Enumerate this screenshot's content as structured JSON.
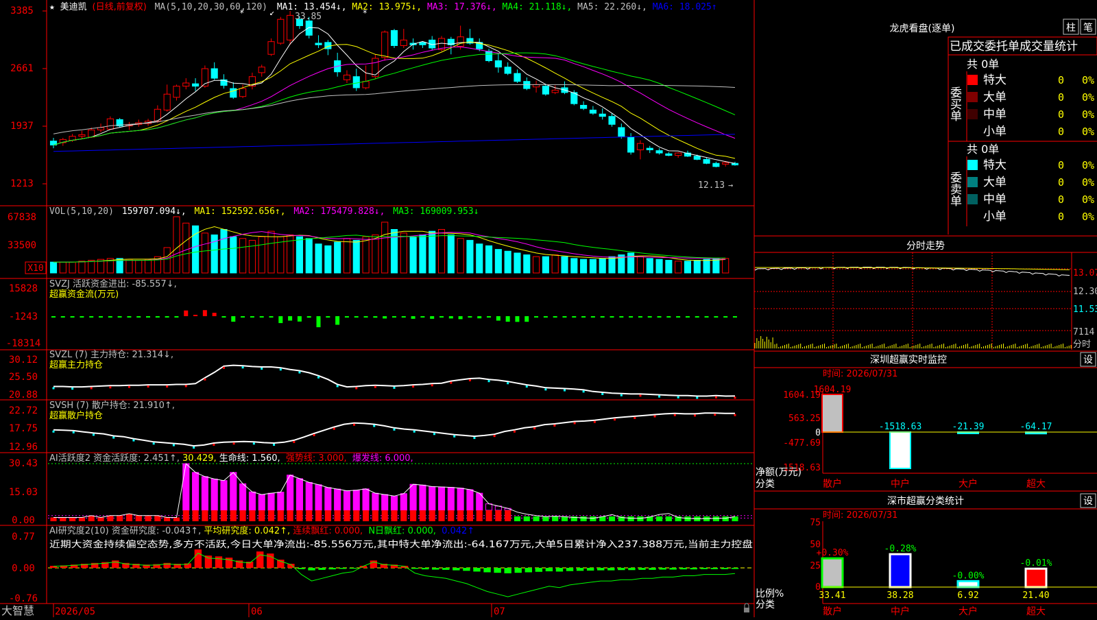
{
  "colors": {
    "up": "#ff0000",
    "down": "#00ffff",
    "ma1": "#ffffff",
    "ma2": "#ffff00",
    "ma3": "#ff00ff",
    "ma4": "#00ff00",
    "ma5": "#c0c0c0",
    "ma6": "#0000ff",
    "axis": "#ff0000",
    "bg": "#000000"
  },
  "header": {
    "star": "★",
    "stock": "美迪凯",
    "period": "(日线,前复权)",
    "ma_params": "MA(5,10,20,30,60,120)",
    "ma1": "MA1: 13.454↓,",
    "ma2": "MA2: 13.975↓,",
    "ma3": "MA3: 17.376↓,",
    "ma4": "MA4: 21.118↓,",
    "ma5": "MA5: 22.260↓,",
    "ma6": "MA6: 18.025↑"
  },
  "price_axis": {
    "ticks": [
      "3385",
      "2661",
      "1937",
      "1213"
    ]
  },
  "annotations": {
    "high": "33.85",
    "low": "12.13"
  },
  "vol_panel": {
    "label": "VOL(5,10,20)",
    "value": "159707.094↓,",
    "ma1": "MA1: 152592.656↑,",
    "ma2": "MA2: 175479.828↓,",
    "ma3": "MA3: 169009.953↓",
    "ticks": [
      "67838",
      "33500"
    ],
    "unit": "X10"
  },
  "svzj_panel": {
    "label": "SVZJ  活跃资金进出: -85.557↓,",
    "sub": "超赢资金流(万元)",
    "ticks": [
      "15828",
      "-1243",
      "-18314"
    ]
  },
  "svzl_panel": {
    "label": "SVZL (7) 主力持仓: 21.314↓,",
    "sub": "超赢主力持仓",
    "ticks": [
      "30.12",
      "25.50",
      "20.88"
    ]
  },
  "svsh_panel": {
    "label": "SVSH (7) 散户持仓: 21.910↑,",
    "sub": "超赢散户持仓",
    "ticks": [
      "22.72",
      "17.75",
      "12.96"
    ]
  },
  "ai1_panel": {
    "label": "AI活跃度2 资金活跃度: 2.451↑,",
    "val2": "30.429,",
    "life": "生命线: 1.560,",
    "strong": "强势线: 3.000,",
    "burst": "爆发线: 6.000,",
    "ticks": [
      "30.43",
      "15.03",
      "0.00"
    ]
  },
  "ai2_panel": {
    "label": "AI研究度2(10) 资金研究度: -0.043↑,",
    "avg": "平均研究度: 0.042↑,",
    "red": "连续飘红: 0.000,",
    "nred": "N日飘红: 0.000,",
    "last": "0.042↑",
    "comment": "近期大资金持续偏空态势,多方不活跃,今日大单净流出:-85.556万元,其中特大单净流出:-64.167万元,大单5日累计净入237.388万元,当前主力控盘",
    "ticks": [
      "0.77",
      "0.00",
      "-0.76"
    ]
  },
  "date_axis": {
    "brand": "大智慧",
    "labels": [
      "2026/05",
      "06",
      "07"
    ]
  },
  "right": {
    "lhb_title": "龙虎看盘(逐单)",
    "btn_zhu": "柱",
    "btn_bi": "笔",
    "tabs": "已成交委托单成交量统计",
    "buy_side": "委买单",
    "sell_side": "委卖单",
    "buy_total": "共 0单",
    "sell_total": "共 0单",
    "buy_rows": [
      {
        "label": "特大",
        "count": "0",
        "pct": "0%",
        "color": "#ff0000"
      },
      {
        "label": "大单",
        "count": "0",
        "pct": "0%",
        "color": "#800000"
      },
      {
        "label": "中单",
        "count": "0",
        "pct": "0%",
        "color": "#400000"
      },
      {
        "label": "小单",
        "count": "0",
        "pct": "0%",
        "color": "#000000"
      }
    ],
    "sell_rows": [
      {
        "label": "特大",
        "count": "0",
        "pct": "0%",
        "color": "#00ffff"
      },
      {
        "label": "大单",
        "count": "0",
        "pct": "0%",
        "color": "#008080"
      },
      {
        "label": "中单",
        "count": "0",
        "pct": "0%",
        "color": "#006060"
      },
      {
        "label": "小单",
        "count": "0",
        "pct": "0%",
        "color": "#000000"
      }
    ],
    "fs_title": "分时走势",
    "fs_ticks": [
      "13.07",
      "12.30",
      "11.53",
      "7114"
    ],
    "fs_unit": "分时",
    "sz_title": "深圳超赢实时监控",
    "sz_set": "设",
    "sz_time": "时间: 2026/07/31",
    "sz_ticks": [
      "1604.19",
      "563.25",
      "0",
      "-477.69",
      "-1518.63"
    ],
    "sz_values": [
      "1604.19",
      "-1518.63",
      "-21.39",
      "-64.17"
    ],
    "sz_cats": [
      "散户",
      "中户",
      "大户",
      "超大"
    ],
    "sz_ylabel": "净额(万元)",
    "sz_xlabel": "分类",
    "ss_title": "深市超赢分类统计",
    "ss_set": "设",
    "ss_time": "时间: 2026/07/31",
    "ss_ticks": [
      "75",
      "50",
      "25",
      "0"
    ],
    "ss_top": [
      "+0.30%",
      "-0.28%",
      "-0.00%",
      "-0.01%"
    ],
    "ss_bottom": [
      "33.41",
      "38.28",
      "6.92",
      "21.40"
    ],
    "ss_cats": [
      "散户",
      "中户",
      "大户",
      "超大"
    ],
    "ss_ylabel": "比例%",
    "ss_xlabel": "分类"
  },
  "chart_data": [
    {
      "type": "candlestick",
      "title": "美迪凯 (日线,前复权)",
      "candles": [
        {
          "o": 17.5,
          "h": 17.9,
          "l": 16.6,
          "c": 17.0
        },
        {
          "o": 17.3,
          "h": 17.9,
          "l": 16.9,
          "c": 17.7
        },
        {
          "o": 17.6,
          "h": 18.4,
          "l": 17.4,
          "c": 18.1
        },
        {
          "o": 18.1,
          "h": 18.8,
          "l": 17.8,
          "c": 18.3
        },
        {
          "o": 18.0,
          "h": 19.2,
          "l": 17.9,
          "c": 18.9
        },
        {
          "o": 18.9,
          "h": 19.7,
          "l": 18.6,
          "c": 19.2
        },
        {
          "o": 19.0,
          "h": 20.6,
          "l": 18.9,
          "c": 20.3
        },
        {
          "o": 20.2,
          "h": 20.4,
          "l": 19.2,
          "c": 19.4
        },
        {
          "o": 19.4,
          "h": 19.9,
          "l": 18.9,
          "c": 19.6
        },
        {
          "o": 19.6,
          "h": 20.2,
          "l": 19.3,
          "c": 19.8
        },
        {
          "o": 19.7,
          "h": 20.3,
          "l": 19.4,
          "c": 20.0
        },
        {
          "o": 20.0,
          "h": 22.0,
          "l": 19.8,
          "c": 21.5
        },
        {
          "o": 21.4,
          "h": 24.6,
          "l": 21.2,
          "c": 23.4
        },
        {
          "o": 23.0,
          "h": 24.6,
          "l": 22.6,
          "c": 24.4
        },
        {
          "o": 24.4,
          "h": 25.4,
          "l": 24.0,
          "c": 24.8
        },
        {
          "o": 24.7,
          "h": 25.4,
          "l": 23.8,
          "c": 24.4
        },
        {
          "o": 24.4,
          "h": 27.0,
          "l": 24.2,
          "c": 26.6
        },
        {
          "o": 26.6,
          "h": 27.4,
          "l": 25.2,
          "c": 25.4
        },
        {
          "o": 25.2,
          "h": 25.9,
          "l": 24.1,
          "c": 24.5
        },
        {
          "o": 24.1,
          "h": 24.9,
          "l": 22.8,
          "c": 23.0
        },
        {
          "o": 23.1,
          "h": 24.6,
          "l": 22.9,
          "c": 24.1
        },
        {
          "o": 24.4,
          "h": 26.1,
          "l": 24.0,
          "c": 25.6
        },
        {
          "o": 26.1,
          "h": 27.1,
          "l": 25.6,
          "c": 26.8
        },
        {
          "o": 28.4,
          "h": 30.4,
          "l": 28.2,
          "c": 30.0
        },
        {
          "o": 29.8,
          "h": 33.1,
          "l": 29.6,
          "c": 32.8
        },
        {
          "o": 30.2,
          "h": 33.85,
          "l": 29.6,
          "c": 33.3
        },
        {
          "o": 32.8,
          "h": 33.2,
          "l": 31.6,
          "c": 32.0
        },
        {
          "o": 32.6,
          "h": 33.1,
          "l": 30.4,
          "c": 30.8
        },
        {
          "o": 29.8,
          "h": 30.8,
          "l": 29.2,
          "c": 29.6
        },
        {
          "o": 29.9,
          "h": 30.2,
          "l": 28.3,
          "c": 29.1
        },
        {
          "o": 27.6,
          "h": 28.6,
          "l": 25.6,
          "c": 26.2
        },
        {
          "o": 25.2,
          "h": 26.4,
          "l": 24.8,
          "c": 25.8
        },
        {
          "o": 25.6,
          "h": 26.6,
          "l": 23.8,
          "c": 24.2
        },
        {
          "o": 24.2,
          "h": 27.0,
          "l": 24.0,
          "c": 25.0
        },
        {
          "o": 25.6,
          "h": 28.4,
          "l": 25.3,
          "c": 27.9
        },
        {
          "o": 28.0,
          "h": 31.4,
          "l": 27.6,
          "c": 31.2
        },
        {
          "o": 31.4,
          "h": 31.6,
          "l": 29.2,
          "c": 29.5
        },
        {
          "o": 29.5,
          "h": 31.6,
          "l": 29.2,
          "c": 30.2
        },
        {
          "o": 29.8,
          "h": 30.4,
          "l": 29.0,
          "c": 29.6
        },
        {
          "o": 29.9,
          "h": 30.0,
          "l": 29.2,
          "c": 29.6
        },
        {
          "o": 30.2,
          "h": 30.7,
          "l": 28.9,
          "c": 29.2
        },
        {
          "o": 29.0,
          "h": 30.7,
          "l": 28.8,
          "c": 30.4
        },
        {
          "o": 30.3,
          "h": 30.6,
          "l": 28.4,
          "c": 29.6
        },
        {
          "o": 29.4,
          "h": 32.0,
          "l": 29.0,
          "c": 30.6
        },
        {
          "o": 30.4,
          "h": 31.6,
          "l": 29.6,
          "c": 29.8
        },
        {
          "o": 29.9,
          "h": 30.4,
          "l": 28.8,
          "c": 29.1
        },
        {
          "o": 28.8,
          "h": 29.1,
          "l": 27.4,
          "c": 27.6
        },
        {
          "o": 27.6,
          "h": 28.5,
          "l": 26.1,
          "c": 26.8
        },
        {
          "o": 26.8,
          "h": 27.4,
          "l": 25.8,
          "c": 26.0
        },
        {
          "o": 26.0,
          "h": 26.5,
          "l": 24.8,
          "c": 25.0
        },
        {
          "o": 25.0,
          "h": 25.5,
          "l": 23.9,
          "c": 24.1
        },
        {
          "o": 24.3,
          "h": 25.1,
          "l": 23.6,
          "c": 24.6
        },
        {
          "o": 24.4,
          "h": 24.7,
          "l": 23.2,
          "c": 23.4
        },
        {
          "o": 23.6,
          "h": 24.5,
          "l": 23.4,
          "c": 23.9
        },
        {
          "o": 24.2,
          "h": 25.0,
          "l": 23.4,
          "c": 23.6
        },
        {
          "o": 23.6,
          "h": 23.9,
          "l": 22.0,
          "c": 22.2
        },
        {
          "o": 22.0,
          "h": 22.5,
          "l": 21.4,
          "c": 21.6
        },
        {
          "o": 21.4,
          "h": 21.9,
          "l": 20.8,
          "c": 21.0
        },
        {
          "o": 20.9,
          "h": 21.6,
          "l": 20.2,
          "c": 20.6
        },
        {
          "o": 20.6,
          "h": 21.0,
          "l": 19.3,
          "c": 19.6
        },
        {
          "o": 19.2,
          "h": 19.7,
          "l": 17.8,
          "c": 18.1
        },
        {
          "o": 18.0,
          "h": 18.5,
          "l": 15.8,
          "c": 16.1
        },
        {
          "o": 16.4,
          "h": 17.6,
          "l": 15.2,
          "c": 17.2
        },
        {
          "o": 16.6,
          "h": 16.9,
          "l": 16.0,
          "c": 16.4
        },
        {
          "o": 16.3,
          "h": 16.6,
          "l": 15.8,
          "c": 16.0
        },
        {
          "o": 15.9,
          "h": 16.1,
          "l": 15.6,
          "c": 15.7
        },
        {
          "o": 15.7,
          "h": 16.1,
          "l": 15.4,
          "c": 16.0
        },
        {
          "o": 16.0,
          "h": 16.3,
          "l": 15.5,
          "c": 15.6
        },
        {
          "o": 15.6,
          "h": 15.8,
          "l": 15.1,
          "c": 15.2
        },
        {
          "o": 15.2,
          "h": 15.4,
          "l": 14.6,
          "c": 14.7
        },
        {
          "o": 14.7,
          "h": 14.9,
          "l": 14.2,
          "c": 14.3
        },
        {
          "o": 14.6,
          "h": 15.0,
          "l": 14.3,
          "c": 14.8
        },
        {
          "o": 14.7,
          "h": 14.9,
          "l": 14.4,
          "c": 14.5
        }
      ],
      "ma_levels": {
        "MA1": 13.454,
        "MA2": 13.975,
        "MA3": 17.376,
        "MA4": 21.118,
        "MA5": 22.26,
        "MA6": 18.025
      },
      "high": 33.85,
      "low": 12.13
    },
    {
      "type": "bar",
      "title": "VOL(5,10,20)",
      "values": [
        12,
        12,
        12,
        13,
        14,
        15,
        16,
        16,
        15,
        14,
        15,
        18,
        28,
        62,
        55,
        52,
        44,
        42,
        48,
        40,
        38,
        36,
        40,
        46,
        40,
        42,
        40,
        38,
        32,
        30,
        34,
        38,
        36,
        40,
        42,
        56,
        48,
        44,
        40,
        42,
        46,
        48,
        42,
        38,
        36,
        32,
        30,
        26,
        24,
        22,
        20,
        18,
        18,
        20,
        18,
        16,
        15,
        15,
        16,
        18,
        20,
        22,
        18,
        16,
        15,
        14,
        13,
        13,
        14,
        15,
        16,
        16
      ]
    },
    {
      "type": "bar",
      "title": "超赢资金流(万元)",
      "values": [
        -60,
        -40,
        -120,
        -30,
        -260,
        -80,
        -100,
        -70,
        -50,
        -120,
        -80,
        -90,
        -100,
        -240,
        3200,
        400,
        3400,
        1900,
        -80,
        -3600,
        -520,
        -800,
        -210,
        -160,
        -4500,
        -2900,
        -3500,
        -960,
        -7200,
        -420,
        -5600,
        -250,
        -750,
        -70,
        -1000,
        -1500,
        -260,
        -180,
        -1700,
        -420,
        -1700,
        -820,
        -1480,
        -1960,
        -140,
        -1400,
        -150,
        -2900,
        -3620,
        -3720,
        -3660,
        -200,
        -120,
        -400,
        -200,
        -500,
        -150,
        -120,
        -220,
        -60,
        -300,
        -320,
        -520,
        -120,
        -200,
        -300,
        -230,
        -100,
        -240,
        -250,
        -300,
        -200,
        -85.557
      ]
    },
    {
      "type": "line",
      "title": "超赢主力持仓",
      "values": [
        23.6,
        23.6,
        23.5,
        23.5,
        23.6,
        23.7,
        23.8,
        23.8,
        23.9,
        23.9,
        24.0,
        24.0,
        24.0,
        24.1,
        24.1,
        24.3,
        25.7,
        27.0,
        28.5,
        28.7,
        28.6,
        28.4,
        28.3,
        28.3,
        28.1,
        27.7,
        27.4,
        26.9,
        26.2,
        25.3,
        24.1,
        23.5,
        23.6,
        23.8,
        23.9,
        23.8,
        23.7,
        23.8,
        24.0,
        24.1,
        24.3,
        24.4,
        24.9,
        25.2,
        25.5,
        25.6,
        25.3,
        25.1,
        24.8,
        24.4,
        24.0,
        23.7,
        23.3,
        23.2,
        23.1,
        23.0,
        22.8,
        22.4,
        22.2,
        22.0,
        21.9,
        21.8,
        21.8,
        21.7,
        21.6,
        21.5,
        21.4,
        21.4,
        21.3,
        21.3,
        21.4,
        21.3,
        21.314
      ]
    },
    {
      "type": "line",
      "title": "超赢散户持仓",
      "values": [
        17.8,
        17.7,
        17.6,
        17.3,
        17.0,
        16.8,
        16.3,
        16.1,
        15.6,
        15.2,
        14.8,
        14.6,
        14.4,
        14.2,
        13.8,
        14.0,
        14.5,
        14.7,
        14.8,
        14.9,
        14.8,
        14.6,
        14.5,
        14.7,
        15.2,
        16.0,
        16.9,
        17.7,
        18.5,
        19.2,
        19.5,
        19.4,
        19.2,
        18.8,
        18.3,
        18.0,
        17.8,
        17.5,
        17.2,
        16.9,
        16.6,
        16.4,
        16.2,
        16.4,
        16.7,
        17.4,
        17.8,
        18.3,
        18.6,
        19.1,
        19.3,
        19.6,
        19.9,
        20.0,
        20.2,
        20.5,
        20.8,
        21.0,
        21.2,
        21.4,
        21.6,
        21.8,
        21.9,
        21.8,
        21.8,
        22.0,
        22.0,
        21.9,
        21.91
      ]
    },
    {
      "type": "bar",
      "title": "AI活跃度2",
      "values": [
        2,
        2,
        2,
        2,
        3,
        2,
        3,
        3,
        4,
        3,
        3,
        3,
        2,
        2,
        30.4,
        25.8,
        23.6,
        22.3,
        21.5,
        25.8,
        19.8,
        15.5,
        14.1,
        14.8,
        15.4,
        24.4,
        22.5,
        20.5,
        19.3,
        17.8,
        17.0,
        16.1,
        16.4,
        17.1,
        14.8,
        14.1,
        13.3,
        14.6,
        19.5,
        19.1,
        18.3,
        18.1,
        17.9,
        17.5,
        16.7,
        14.8,
        9.2,
        8.0,
        6.8,
        4.8,
        3.7,
        3.0,
        2.4,
        2.6,
        2.4,
        2.0,
        1.8,
        1.6,
        2.4,
        3.5,
        2.0,
        1.6,
        1.5,
        2.2,
        3.6,
        4.1,
        2.0,
        1.5,
        1.3,
        1.4,
        1.5,
        1.6,
        2.451
      ],
      "life": 1.56,
      "strong": 3.0,
      "burst": 6.0
    },
    {
      "type": "bar",
      "title": "AI研究度2(10)",
      "values": [
        0.05,
        0.06,
        0.08,
        0.1,
        0.12,
        0.14,
        0.18,
        0.12,
        0.1,
        0.08,
        0.09,
        0.12,
        0.1,
        0.11,
        0.45,
        0.3,
        0.28,
        0.25,
        0.18,
        0.15,
        0.4,
        0.35,
        0.2,
        0.1,
        -0.05,
        -0.1,
        -0.08,
        -0.06,
        -0.04,
        -0.03,
        0.05,
        0.18,
        0.1,
        0.08,
        0.05,
        -0.04,
        -0.06,
        -0.07,
        -0.08,
        -0.1,
        -0.12,
        -0.15,
        -0.18,
        -0.2,
        -0.22,
        -0.2,
        -0.18,
        -0.16,
        -0.14,
        -0.15,
        -0.13,
        -0.12,
        -0.11,
        -0.1,
        -0.1,
        -0.09,
        -0.09,
        -0.08,
        -0.08,
        -0.07,
        -0.07,
        -0.06,
        -0.06,
        -0.05,
        -0.05,
        -0.05,
        -0.043
      ],
      "avg": 0.042
    }
  ]
}
